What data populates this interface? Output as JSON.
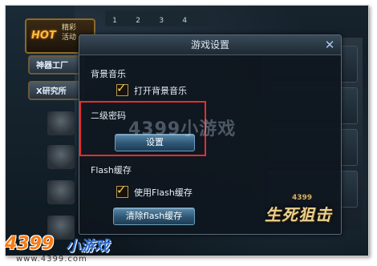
{
  "window": {
    "title": "游戏设置"
  },
  "background_sidebar": {
    "hot_badge": "HOT",
    "hot_side_text": [
      "精彩",
      "活动"
    ],
    "menu_items": [
      "神器工厂",
      "X研究所"
    ]
  },
  "background_tabs": [
    "1",
    "2",
    "3",
    "4"
  ],
  "settings": {
    "music_section": "背景音乐",
    "music_checkbox_label": "打开背景音乐",
    "music_checked": true,
    "password_section": "二级密码",
    "password_button": "设置",
    "flash_section": "Flash缓存",
    "flash_checkbox_label": "使用Flash缓存",
    "flash_checked": true,
    "clear_cache_button": "清除flash缓存"
  },
  "watermarks": {
    "center": "4399小游戏",
    "game_logo_small": "4399",
    "game_logo_main": "生死狙击",
    "site_logo_num": "4399",
    "site_logo_cn": "小游戏",
    "site_url": "www.4399.com"
  },
  "colors": {
    "accent_check": "#f2d060",
    "button_blue": "#2e5674",
    "highlight_red": "#e03030",
    "site_orange": "#ff7a10",
    "site_blue": "#2a6ad0"
  }
}
